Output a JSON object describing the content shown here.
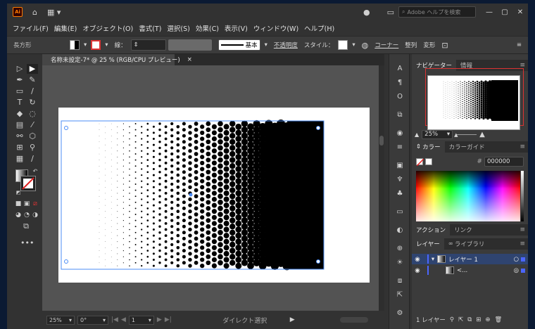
{
  "app": {
    "logo": "Ai",
    "search_placeholder": "Adobe ヘルプを検索"
  },
  "menu": [
    "ファイル(F)",
    "編集(E)",
    "オブジェクト(O)",
    "書式(T)",
    "選択(S)",
    "効果(C)",
    "表示(V)",
    "ウィンドウ(W)",
    "ヘルプ(H)"
  ],
  "control": {
    "object_type": "長方形",
    "stroke_label": "線：",
    "brush_label": "基本",
    "opacity_label": "不透明度",
    "style_label": "スタイル：",
    "corner_label": "コーナー",
    "align_label": "整列",
    "transform_label": "変形"
  },
  "document": {
    "tab_title": "名称未設定-7* @ 25 % (RGB/CPU プレビュー)",
    "close": "×"
  },
  "status": {
    "zoom": "25%",
    "rotate": "0°",
    "artboard": "1",
    "tool": "ダイレクト選択"
  },
  "panels": {
    "navigator_tab": "ナビゲーター",
    "info_tab": "情報",
    "nav_zoom": "25%",
    "color_tab": "カラー",
    "color_guide_tab": "カラーガイド",
    "hex_label": "#",
    "hex_value": "000000",
    "action_tab": "アクション",
    "link_tab": "リンク",
    "layer_tab": "レイヤー",
    "library_tab": "ライブラリ",
    "layer_name": "レイヤー 1",
    "sublayer_name": "<...",
    "footer_label": "1 レイヤー"
  },
  "colors": {
    "accent": "#4b8cf5",
    "layer_color": "#4b66ff"
  }
}
